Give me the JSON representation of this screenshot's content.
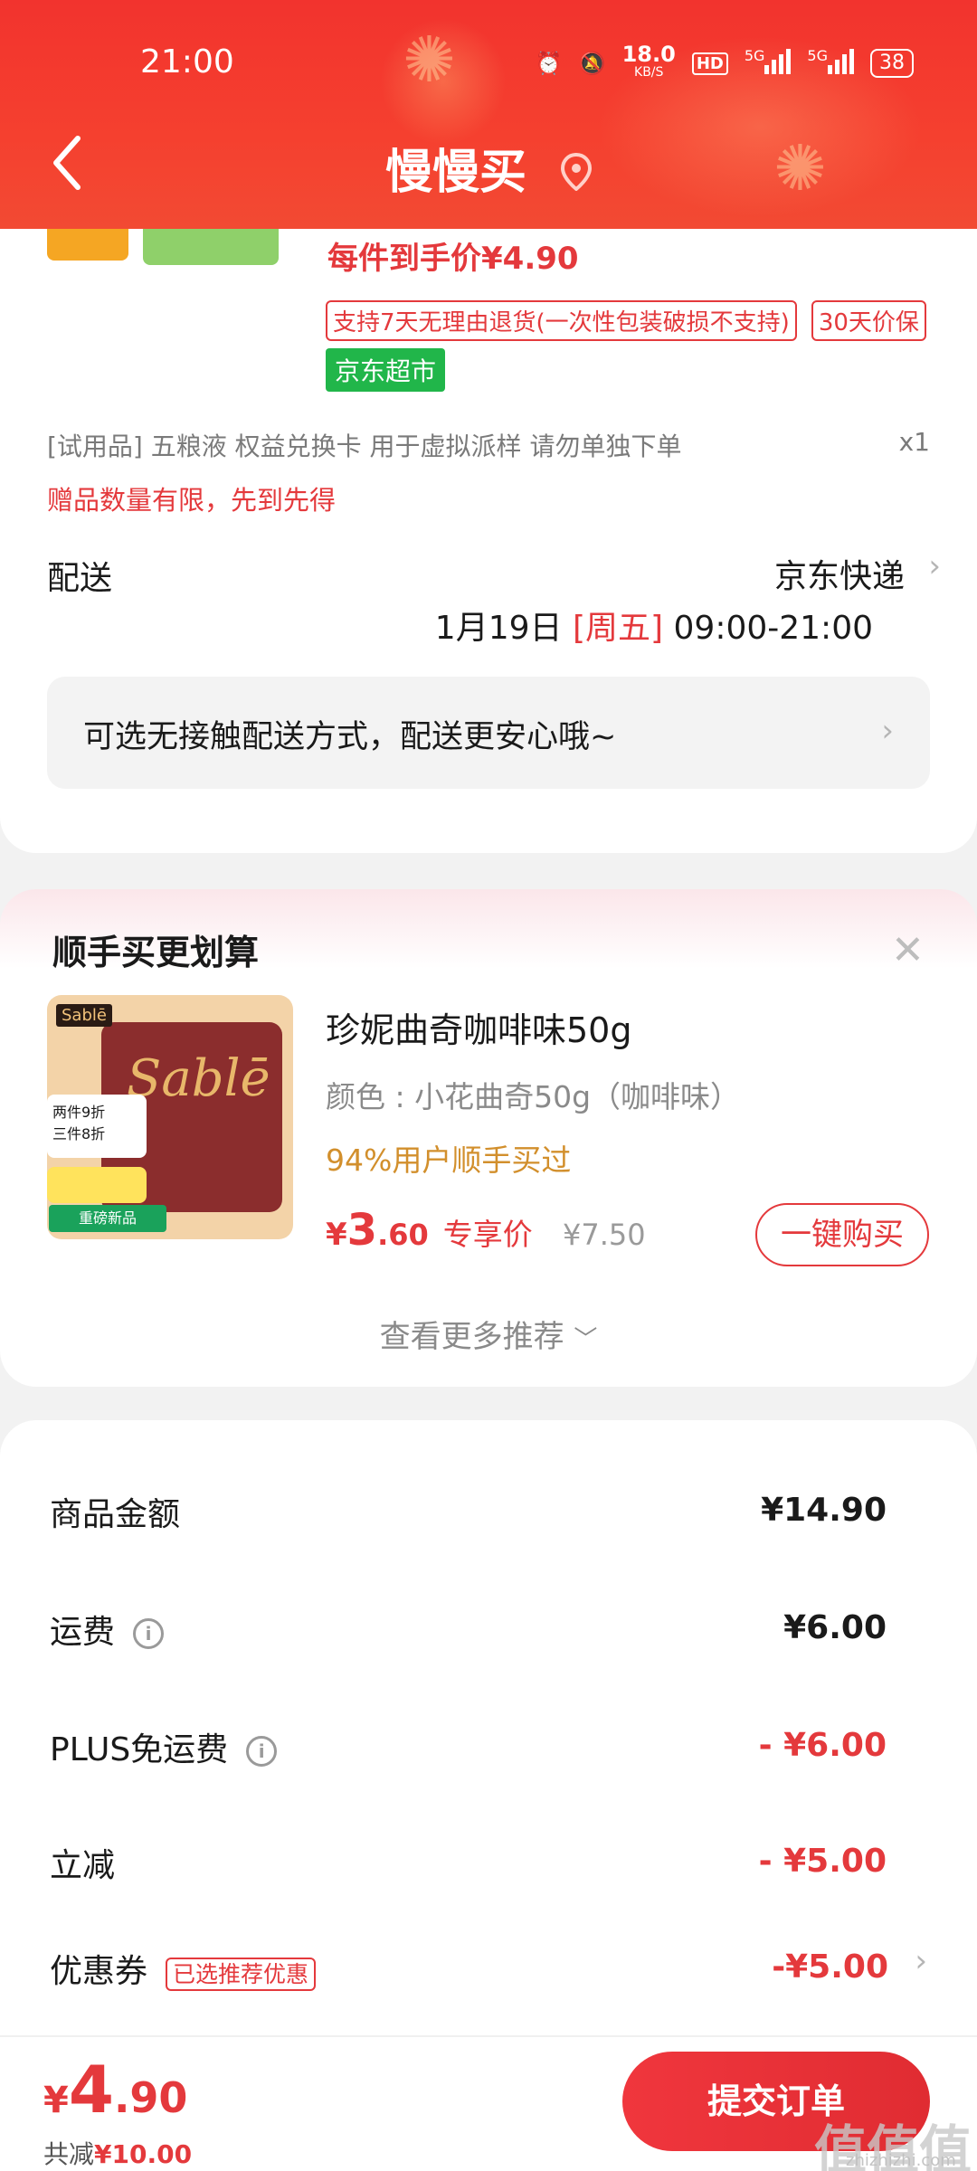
{
  "status_bar": {
    "time": "21:00",
    "net_speed": "18.0",
    "net_unit": "KB/S",
    "hd": "HD",
    "net1": "5G",
    "net2": "5G",
    "battery": "38"
  },
  "header": {
    "title": "慢慢买",
    "back_icon": "chevron-left-icon",
    "location_icon": "location-pin-icon"
  },
  "product": {
    "price_line": "每件到手价¥4.90",
    "tag_return": "支持7天无理由退货(一次性包装破损不支持)",
    "tag_price_protect": "30天价保",
    "tag_store": "京东超市"
  },
  "trial_item": {
    "text": "[试用品]  五粮液 权益兑换卡 用于虚拟派样 请勿单独下单",
    "qty": "x1",
    "note": "赠品数量有限，先到先得"
  },
  "delivery": {
    "label": "配送",
    "method": "京东快递",
    "date": "1月19日",
    "weekday": "[周五]",
    "time_range": "09:00-21:00",
    "contactless": "可选无接触配送方式，配送更安心哦~"
  },
  "recommend": {
    "title": "顺手买更划算",
    "close": "✕",
    "item": {
      "name": "珍妮曲奇咖啡味50g",
      "spec": "颜色 : 小花曲奇50g（咖啡味）",
      "social": "94%用户顺手买过",
      "price_currency": "¥",
      "price_int": "3",
      "price_dec": ".60",
      "price_label": "专享价",
      "orig_price": "¥7.50",
      "buy_label": "一键购买",
      "img_logo": "Sablē",
      "img_brand": "Sablē",
      "img_badge": "两件9折\n三件8折",
      "img_new": "重磅新品"
    },
    "more": "查看更多推荐"
  },
  "summary": {
    "rows": [
      {
        "label": "商品金额",
        "value": "¥14.90",
        "red": false,
        "info": false
      },
      {
        "label": "运费",
        "value": "¥6.00",
        "red": false,
        "info": true
      },
      {
        "label": "PLUS免运费",
        "value": "- ¥6.00",
        "red": true,
        "info": true
      },
      {
        "label": "立减",
        "value": "- ¥5.00",
        "red": true,
        "info": false
      },
      {
        "label": "优惠券",
        "value": "-¥5.00",
        "red": true,
        "info": false,
        "tag": "已选推荐优惠"
      }
    ]
  },
  "footer": {
    "currency": "¥",
    "total_int": "4",
    "total_dec": ".90",
    "saved_label": "共减",
    "saved_value": "¥10.00",
    "submit": "提交订单",
    "watermark": "值值值",
    "watermark_sub": "zhizhizhi.com"
  },
  "colors": {
    "accent_red": "#e4393c",
    "header_red": "#f2332e",
    "store_green": "#21b64a"
  }
}
